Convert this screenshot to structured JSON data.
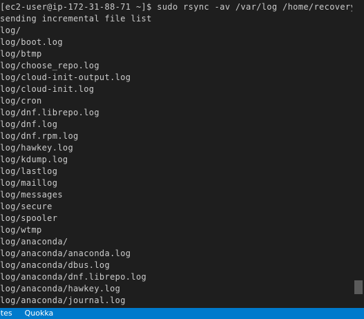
{
  "terminal": {
    "lines": [
      "[ec2-user@ip-172-31-88-71 ~]$ sudo rsync -av /var/log /home/recovery/logs",
      "sending incremental file list",
      "log/",
      "log/boot.log",
      "log/btmp",
      "log/choose_repo.log",
      "log/cloud-init-output.log",
      "log/cloud-init.log",
      "log/cron",
      "log/dnf.librepo.log",
      "log/dnf.log",
      "log/dnf.rpm.log",
      "log/hawkey.log",
      "log/kdump.log",
      "log/lastlog",
      "log/maillog",
      "log/messages",
      "log/secure",
      "log/spooler",
      "log/wtmp",
      "log/anaconda/",
      "log/anaconda/anaconda.log",
      "log/anaconda/dbus.log",
      "log/anaconda/dnf.librepo.log",
      "log/anaconda/hawkey.log",
      "log/anaconda/journal.log"
    ]
  },
  "status_bar": {
    "item_1": "etes",
    "item_2": "Quokka"
  },
  "colors": {
    "background": "#1e1e1e",
    "text": "#cccccc",
    "status_bar": "#007acc",
    "scrollbar_thumb": "#5a5a5a"
  }
}
